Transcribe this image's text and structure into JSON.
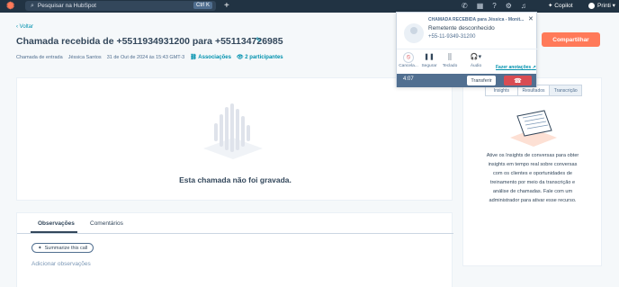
{
  "topbar": {
    "search_placeholder": "Pesquisar na HubSpot",
    "search_shortcut": "Ctrl K",
    "copilot_label": "Copilot",
    "account_label": "Printi"
  },
  "header": {
    "back_label": "Voltar",
    "title": "Chamada recebida de +5511934931200 para +551134726985",
    "meta": {
      "type": "Chamada de entrada",
      "owner": "Jéssica Santos",
      "datetime": "31 de Out de 2024 às 15:43 GMT-3",
      "associations_label": "Associações",
      "participants_label": "2 participantes"
    },
    "primary_button_label": "Compartilhar"
  },
  "recording": {
    "empty_message": "Esta chamada não foi gravada."
  },
  "notes": {
    "tabs": [
      "Observações",
      "Comentários"
    ],
    "summarize_label": "Summarize this call",
    "add_notes_placeholder": "Adicionar observações"
  },
  "side_panel": {
    "tabs": [
      "Insights",
      "Resultados",
      "Transcrição"
    ],
    "description": "Ative os Insights de conversas para obter insights em tempo real sobre conversas com os clientes e oportunidades de treinamento por meio da transcrição e análise de chamadas. Fale com um administrador para ativar esse recurso."
  },
  "call_widget": {
    "heading": "CHAMADA RECEBIDA para Jéssica - Monit...",
    "caller_name": "Remetente desconhecido",
    "caller_number": "+55-11-9349-31200",
    "controls": [
      {
        "label": "Cancela..."
      },
      {
        "label": "Segurar"
      },
      {
        "label": "Teclado"
      },
      {
        "label": "Áudio"
      }
    ],
    "notes_link": "Fazer anotações",
    "timer": "4:07",
    "transfer_label": "Transferir"
  },
  "colors": {
    "nav_bg": "#213343",
    "accent": "#ff7a59",
    "link": "#0091ae",
    "hangup": "#d94c53",
    "widget_bar": "#516f90"
  }
}
